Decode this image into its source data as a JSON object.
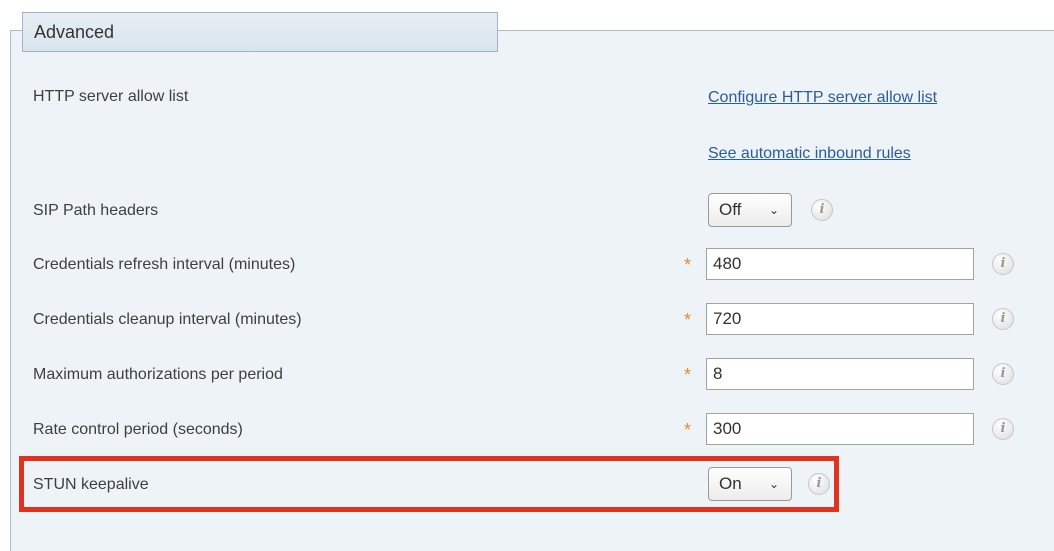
{
  "section": {
    "title": "Advanced"
  },
  "rows": {
    "http_allow": {
      "label": "HTTP server allow list",
      "link1": "Configure HTTP server allow list",
      "link2": "See automatic inbound rules"
    },
    "sip_path": {
      "label": "SIP Path headers",
      "value": "Off"
    },
    "cred_refresh": {
      "label": "Credentials refresh interval (minutes)",
      "value": "480"
    },
    "cred_cleanup": {
      "label": "Credentials cleanup interval (minutes)",
      "value": "720"
    },
    "max_auth": {
      "label": "Maximum authorizations per period",
      "value": "8"
    },
    "rate_period": {
      "label": "Rate control period (seconds)",
      "value": "300"
    },
    "stun": {
      "label": "STUN keepalive",
      "value": "On"
    }
  },
  "icons": {
    "info": "i",
    "required": "*",
    "chevron": "⌄"
  },
  "colors": {
    "highlight": "#e0321e",
    "required": "#f08a2c",
    "link": "#2a5d9c"
  }
}
